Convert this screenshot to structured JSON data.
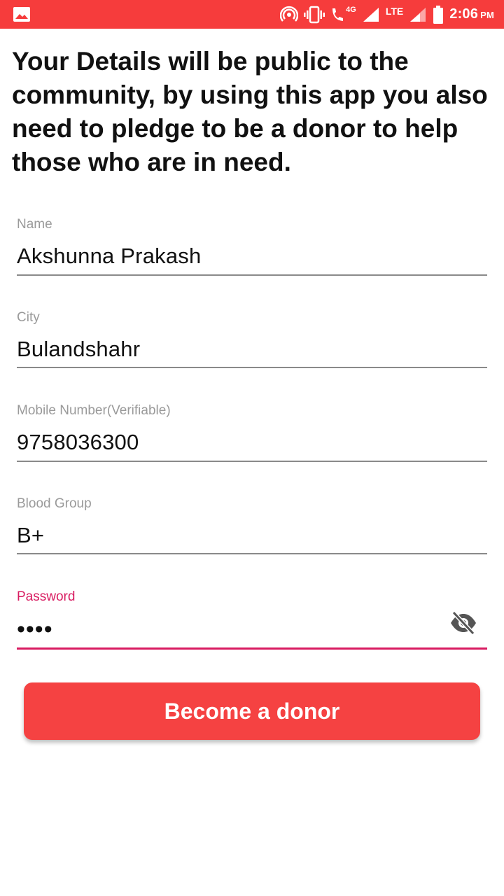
{
  "status_bar": {
    "time": "2:06",
    "ampm": "PM",
    "network_4g": "4G",
    "network_lte": "LTE",
    "icons": [
      "gallery-icon",
      "hotspot-icon",
      "vibrate-icon",
      "wifi-call-icon",
      "signal-icon",
      "battery-icon"
    ]
  },
  "notice": "Your Details will be public to the community, by using this app you also need to pledge to be a donor to help those who are in need.",
  "form": {
    "name": {
      "label": "Name",
      "value": "Akshunna Prakash"
    },
    "city": {
      "label": "City",
      "value": "Bulandshahr"
    },
    "mobile": {
      "label": "Mobile Number(Verifiable)",
      "value": "9758036300"
    },
    "blood_group": {
      "label": "Blood Group",
      "value": "B+"
    },
    "password": {
      "label": "Password",
      "value": "••••",
      "toggle_icon": "eye-off-icon"
    }
  },
  "button": {
    "label": "Become a donor"
  },
  "colors": {
    "status_bar": "#f63c3c",
    "accent": "#d81b60",
    "button": "#f54242",
    "label": "#9a9a9a"
  }
}
